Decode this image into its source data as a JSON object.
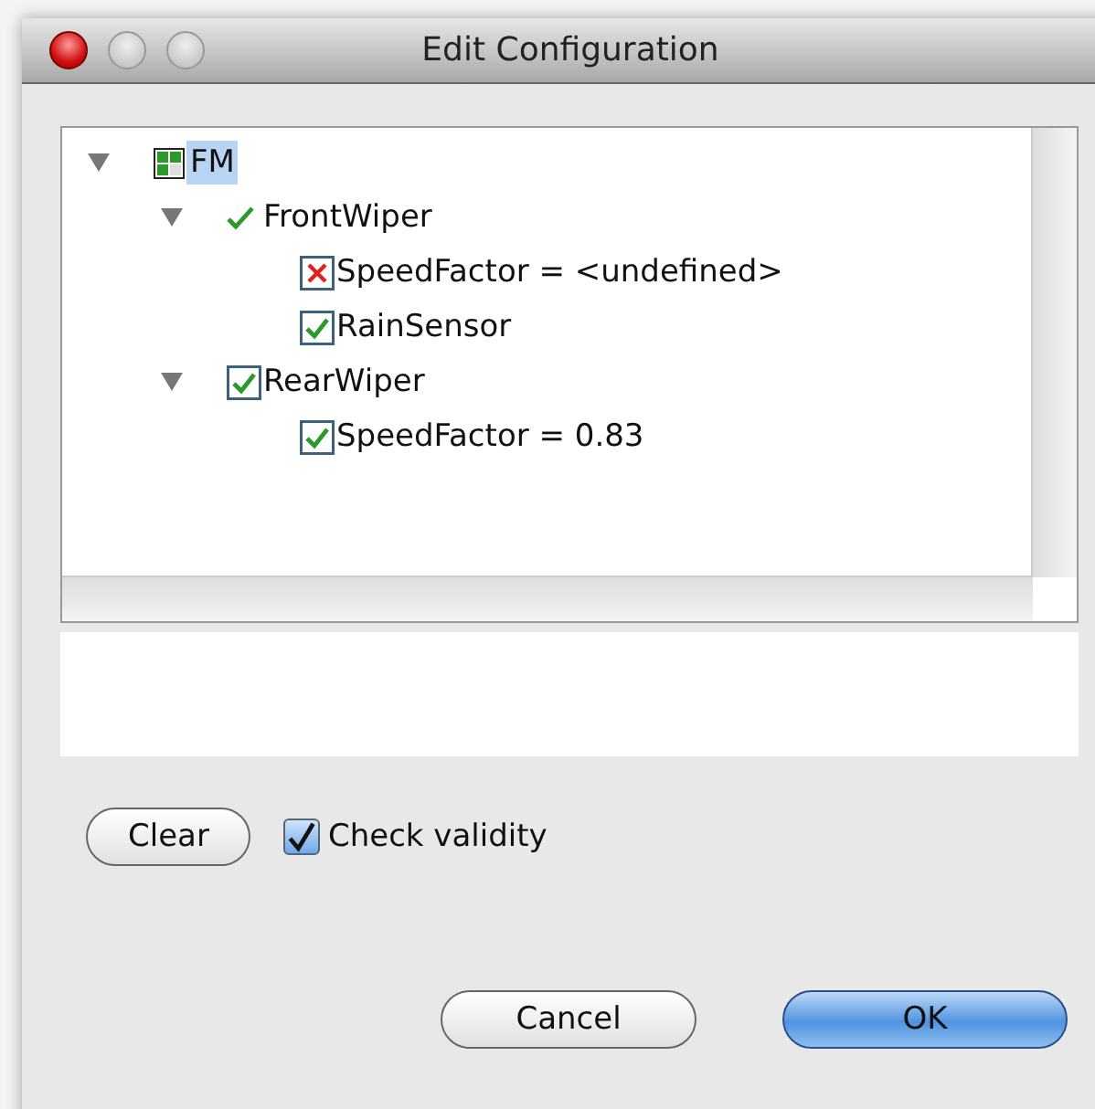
{
  "window": {
    "title": "Edit Configuration"
  },
  "tree": [
    {
      "label": "FM",
      "kind": "feature",
      "selected": true,
      "expanded": true,
      "children": [
        {
          "label": "FrontWiper",
          "kind": "valid",
          "selected": false,
          "expanded": true,
          "children": [
            {
              "label": "SpeedFactor = <undefined>",
              "kind": "invalid",
              "selected": false
            },
            {
              "label": "RainSensor",
              "kind": "checked",
              "selected": false
            }
          ]
        },
        {
          "label": "RearWiper",
          "kind": "checked",
          "selected": false,
          "expanded": true,
          "children": [
            {
              "label": "SpeedFactor = 0.83",
              "kind": "checked",
              "selected": false
            }
          ]
        }
      ]
    }
  ],
  "buttons": {
    "clear": "Clear",
    "cancel": "Cancel",
    "ok": "OK"
  },
  "check_validity": {
    "label": "Check validity",
    "checked": true
  }
}
